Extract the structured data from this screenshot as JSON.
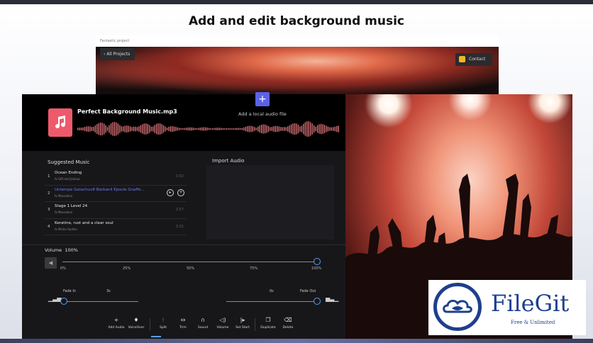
{
  "headline": "Add and edit background music",
  "back_window": {
    "title": "Fantastic project",
    "all_projects_label": "All Projects",
    "contact_label": "Contact"
  },
  "editor": {
    "file_title": "Perfect Background Music.mp3",
    "suggested_title": "Suggested Music",
    "import_title": "Import Audio",
    "import_label": "Add a local audio file",
    "tracks": [
      {
        "num": "1",
        "name": "Ocean Ending",
        "author": "fx Gift and Joshua",
        "duration": "3:02"
      },
      {
        "num": "2",
        "name": "Untempe Gatachuv8 Barbanli Epsule Gnaffe...",
        "author": "fx Macoolion",
        "duration": ""
      },
      {
        "num": "3",
        "name": "Stage 1 Level 24",
        "author": "fx Macoolion",
        "duration": "3:57"
      },
      {
        "num": "4",
        "name": "Keratine, rust and a clear soul",
        "author": "fx Misho Audion",
        "duration": "3:31"
      }
    ],
    "volume": {
      "label": "Volume",
      "value": "100%",
      "level": 1.0,
      "ticks": [
        "0%",
        "25%",
        "50%",
        "75%",
        "100%"
      ]
    },
    "fade_in": {
      "label": "Fade In",
      "value": "3s"
    },
    "fade_out": {
      "label": "Fade Out",
      "value": "0s"
    },
    "tools": [
      {
        "label": "Add Audio",
        "icon": "plus-icon"
      },
      {
        "label": "VoiceOver",
        "icon": "mic-icon"
      },
      {
        "label": "Split",
        "icon": "split-icon"
      },
      {
        "label": "Trim",
        "icon": "trim-icon"
      },
      {
        "label": "Sound",
        "icon": "headphones-icon"
      },
      {
        "label": "Volume",
        "icon": "speaker-icon"
      },
      {
        "label": "Set Start",
        "icon": "set-start-icon"
      },
      {
        "label": "Duplicate",
        "icon": "duplicate-icon"
      },
      {
        "label": "Delete",
        "icon": "trash-icon"
      }
    ]
  },
  "watermark": {
    "brand": "FileGit",
    "tagline": "Free & Unlimited"
  },
  "colors": {
    "accent": "#5a9ef0",
    "import_button": "#5a63e8",
    "file_icon": "#ee5a6c",
    "active_track": "#6d7cf2",
    "brand_blue": "#1e3f8f"
  }
}
